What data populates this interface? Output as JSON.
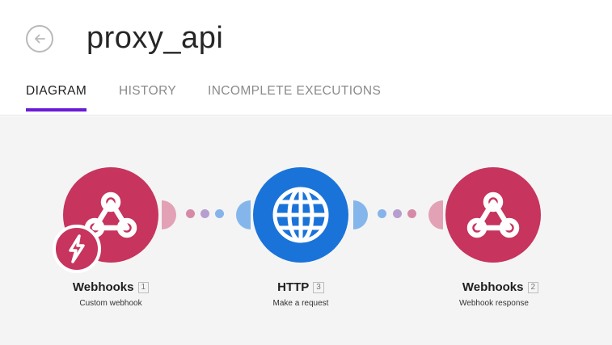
{
  "scenario": {
    "title": "proxy_api"
  },
  "tabs": [
    {
      "label": "DIAGRAM",
      "active": true
    },
    {
      "label": "HISTORY",
      "active": false
    },
    {
      "label": "INCOMPLETE EXECUTIONS",
      "active": false
    }
  ],
  "modules": [
    {
      "name": "Webhooks",
      "number": "1",
      "subtitle": "Custom webhook",
      "icon": "webhook-icon",
      "color": "#c7345e",
      "is_trigger": true
    },
    {
      "name": "HTTP",
      "number": "3",
      "subtitle": "Make a request",
      "icon": "globe-icon",
      "color": "#1a73d9"
    },
    {
      "name": "Webhooks",
      "number": "2",
      "subtitle": "Webhook response",
      "icon": "webhook-icon",
      "color": "#c7345e"
    }
  ],
  "icons": {
    "back": "arrow-left-icon",
    "trigger": "lightning-bolt-icon"
  },
  "colors": {
    "accent": "#6b1bd6",
    "webhook": "#c7345e",
    "http": "#1a73d9",
    "canvas": "#f4f4f4"
  }
}
